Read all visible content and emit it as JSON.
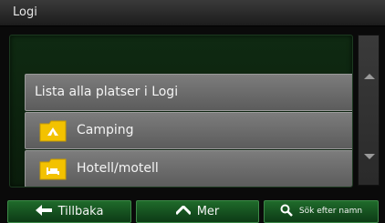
{
  "header": {
    "title": "Logi"
  },
  "list": {
    "items": [
      {
        "label": "Lista alla platser i Logi",
        "icon": "none"
      },
      {
        "label": "Camping",
        "icon": "camping-folder-icon"
      },
      {
        "label": "Hotell/motell",
        "icon": "hotel-folder-icon"
      }
    ]
  },
  "footer": {
    "back_label": "Tillbaka",
    "more_label": "Mer",
    "search_label": "Sök efter namn"
  },
  "colors": {
    "folder": "#f3c200",
    "button": "#1f6a2a",
    "row": "#6e6e6e"
  }
}
